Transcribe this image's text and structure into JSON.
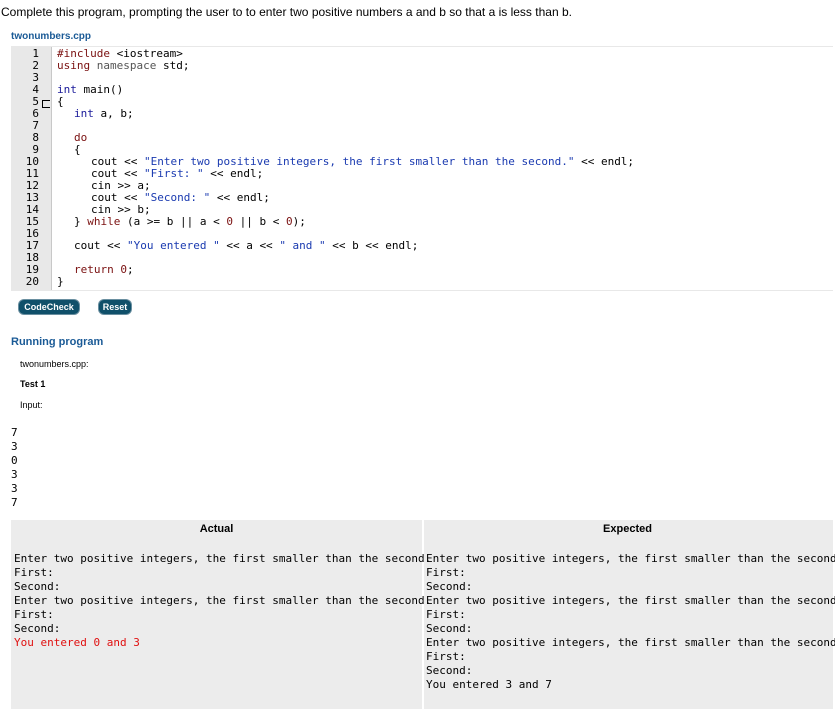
{
  "prompt": "Complete this program, prompting the user to to enter two positive numbers a and b so that a is less than b.",
  "filename": "twonumbers.cpp",
  "line_numbers": [
    "1",
    "2",
    "3",
    "4",
    "5",
    "6",
    "7",
    "8",
    "9",
    "10",
    "11",
    "12",
    "13",
    "14",
    "15",
    "16",
    "17",
    "18",
    "19",
    "20"
  ],
  "code": {
    "l1a": "#include ",
    "l1b": "<iostream>",
    "l2a": "using ",
    "l2b": "namespace",
    "l2c": " std;",
    "l4a": "int",
    "l4b": " main()",
    "l5": "{",
    "l6a": "int",
    "l6b": " a, b;",
    "l8": "do",
    "l9": "{",
    "l10a": "cout << ",
    "l10b": "\"Enter two positive integers, the first smaller than the second.\"",
    "l10c": " << endl;",
    "l11a": "cout << ",
    "l11b": "\"First: \"",
    "l11c": " << endl;",
    "l12": "cin >> a;",
    "l13a": "cout << ",
    "l13b": "\"Second: \"",
    "l13c": " << endl;",
    "l14": "cin >> b;",
    "l15a": "} ",
    "l15b": "while",
    "l15c": " (a >= b || a < ",
    "l15d": "0",
    "l15e": " || b < ",
    "l15f": "0",
    "l15g": ");",
    "l17a": "cout << ",
    "l17b": "\"You entered \"",
    "l17c": " << a << ",
    "l17d": "\" and \"",
    "l17e": " << b << endl;",
    "l19a": "return ",
    "l19b": "0",
    "l19c": ";",
    "l20": "}"
  },
  "buttons": {
    "codecheck": "CodeCheck",
    "reset": "Reset"
  },
  "running": {
    "title": "Running program",
    "file": "twonumbers.cpp:",
    "test": "Test 1",
    "input_label": "Input:",
    "inputs": [
      "7",
      "3",
      "0",
      "3",
      "3",
      "7"
    ]
  },
  "table": {
    "actual_header": "Actual",
    "expected_header": "Expected",
    "actual_lines": [
      "Enter two positive integers, the first smaller than the second.",
      "First:",
      "Second:",
      "Enter two positive integers, the first smaller than the second.",
      "First:",
      "Second:",
      "You entered 0 and 3"
    ],
    "expected_lines": [
      "Enter two positive integers, the first smaller than the second.",
      "First:",
      "Second:",
      "Enter two positive integers, the first smaller than the second.",
      "First:",
      "Second:",
      "Enter two positive integers, the first smaller than the second.",
      "First:",
      "Second:",
      "You entered 3 and 7"
    ]
  },
  "colors": {
    "link_blue": "#1a5a96",
    "button_bg": "#10506a",
    "mismatch_red": "#e01010",
    "table_bg": "#ececec"
  }
}
